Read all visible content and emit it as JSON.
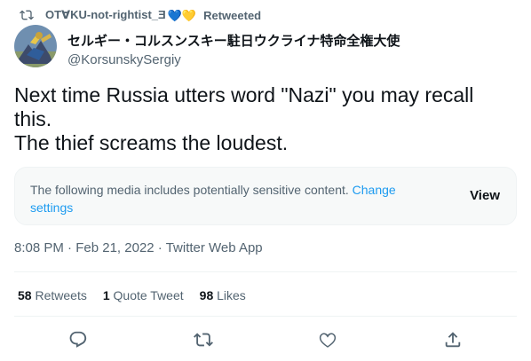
{
  "retweet": {
    "icon": "retweet-icon",
    "user_name": "OT∀KU-not-rightist_Ǝ",
    "hearts": [
      "💙",
      "💛"
    ],
    "label": "Retweeted"
  },
  "author": {
    "avatar": "avatar-image",
    "display_name": "セルギー・コルスンスキー駐日ウクライナ特命全権大使",
    "handle": "@KorsunskySergiy"
  },
  "tweet": {
    "lines": [
      "Next time Russia utters word \"Nazi\" you may recall",
      "this.",
      "The thief screams the loudest."
    ]
  },
  "warning": {
    "text": "The following media includes potentially sensitive content.",
    "link": "Change settings",
    "button": "View"
  },
  "meta": {
    "time": "8:08 PM",
    "date": "Feb 21, 2022",
    "source": "Twitter Web App",
    "separator": "·"
  },
  "stats": [
    {
      "count": "58",
      "label": "Retweets"
    },
    {
      "count": "1",
      "label": "Quote Tweet"
    },
    {
      "count": "98",
      "label": "Likes"
    }
  ],
  "actions": [
    {
      "icon": "reply-icon"
    },
    {
      "icon": "retweet-icon"
    },
    {
      "icon": "like-icon"
    },
    {
      "icon": "share-icon"
    }
  ],
  "colors": {
    "text": "#0f1419",
    "secondary": "#536471",
    "link": "#1d9bf0",
    "card_bg": "#f7f9f9",
    "border": "#eff3f4"
  }
}
